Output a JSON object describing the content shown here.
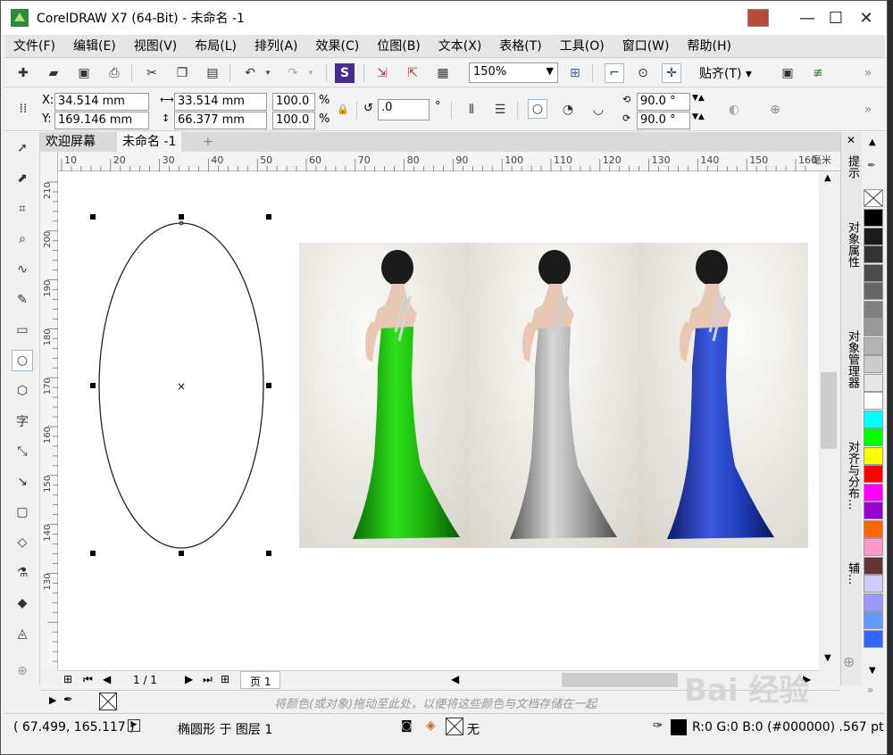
{
  "window": {
    "title": "CorelDRAW X7 (64-Bit) - 未命名 -1",
    "buttons": {
      "minimize": "—",
      "maximize": "☐",
      "close": "✕"
    }
  },
  "menu": [
    "文件(F)",
    "编辑(E)",
    "视图(V)",
    "布局(L)",
    "排列(A)",
    "效果(C)",
    "位图(B)",
    "文本(X)",
    "表格(T)",
    "工具(O)",
    "窗口(W)",
    "帮助(H)"
  ],
  "standard_toolbar": {
    "zoom": "150%",
    "snap": "贴齐(T)"
  },
  "property_bar": {
    "x_label": "X:",
    "x_value": "34.514 mm",
    "y_label": "Y:",
    "y_value": "169.146 mm",
    "width": "33.514 mm",
    "height": "66.377 mm",
    "scale_w": "100.0",
    "scale_h": "100.0",
    "pct": "%",
    "rotation": ".0",
    "deg": "°",
    "start_angle": "90.0 °",
    "end_angle": "90.0 °"
  },
  "doc_tabs": [
    "欢迎屏幕",
    "未命名 -1"
  ],
  "ruler": {
    "unit": "毫米",
    "h_ticks": [
      "10",
      "20",
      "30",
      "40",
      "50",
      "60",
      "70",
      "80",
      "90",
      "100",
      "110",
      "120",
      "130",
      "140",
      "150",
      "160"
    ],
    "v_ticks": [
      "210",
      "200",
      "190",
      "180",
      "170",
      "160",
      "150",
      "140",
      "130"
    ]
  },
  "page_nav": {
    "current": "1 / 1",
    "page_tab": "页 1"
  },
  "color_tray_hint": "将颜色(或对象)拖动至此处，以便将这些颜色与文档存储在一起",
  "dockers": [
    "提示",
    "对象属性",
    "对象管理器",
    "对齐与分布...",
    "辅..."
  ],
  "status": {
    "coords": "( 67.499, 165.117 )",
    "object": "椭圆形 于 图层 1",
    "fill": "无",
    "outline": "R:0 G:0 B:0 (#000000)  .567 pt"
  },
  "palette_colors": [
    "#000000",
    "#1a1a1a",
    "#333333",
    "#4d4d4d",
    "#666666",
    "#808080",
    "#999999",
    "#b3b3b3",
    "#cccccc",
    "#e6e6e6",
    "#ffffff",
    "#00ffff",
    "#00ff00",
    "#ffff00",
    "#ff0000",
    "#ff00ff",
    "#9900cc",
    "#ff6600",
    "#ff99cc",
    "#663333",
    "#ccccff",
    "#9999ff",
    "#6699ff",
    "#3366ff"
  ],
  "dress_colors": {
    "green": "#1fbe12",
    "gray": "#9c9c9c",
    "blue": "#1e3cb4"
  },
  "watermark": "Bai 经验"
}
